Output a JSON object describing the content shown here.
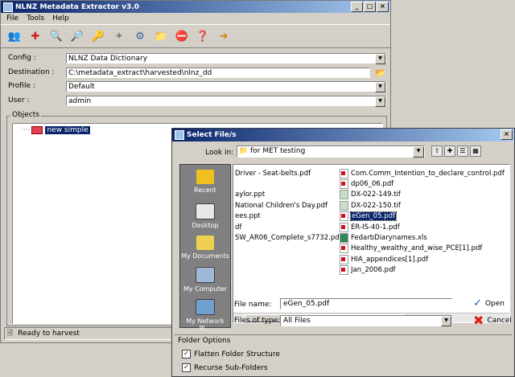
{
  "main_window": {
    "title": "NLNZ Metadata Extractor v3.0",
    "menu": [
      "File",
      "Tools",
      "Help"
    ],
    "toolbar_icons": [
      "users-icon",
      "add-icon",
      "search-icon",
      "search-delete-icon",
      "key-icon",
      "puzzle-icon",
      "config-icon",
      "export-icon",
      "stop-icon",
      "help-icon",
      "exit-icon"
    ],
    "fields": {
      "config_label": "Config :",
      "config_value": "NLNZ Data Dictionary",
      "destination_label": "Destination :",
      "destination_value": "C:\\metadata_extract\\harvested\\nlnz_dd",
      "profile_label": "Profile :",
      "profile_value": "Default",
      "user_label": "User :",
      "user_value": "admin"
    },
    "objects_label": "Objects",
    "tree_item": "new simple",
    "status": "Ready to harvest"
  },
  "dialog": {
    "title": "Select File/s",
    "look_in_label": "Look in:",
    "look_in_value": "for MET testing",
    "places": [
      "Recent",
      "Desktop",
      "My Documents",
      "My Computer",
      "My Network Pl..."
    ],
    "files_col1": [
      "Driver - Seat-belts.pdf",
      "",
      "aylor.ppt",
      "National Children's Day.pdf",
      "ees.ppt",
      "df",
      "SW_AR06_Complete_s7732.pdf"
    ],
    "files_col2": [
      {
        "name": "Com.Comm_Intention_to_declare_control.pdf",
        "type": "pdf"
      },
      {
        "name": "dp06_06.pdf",
        "type": "pdf"
      },
      {
        "name": "DX-022-149.tif",
        "type": "tif"
      },
      {
        "name": "DX-022-150.tif",
        "type": "tif"
      },
      {
        "name": "eGen_05.pdf",
        "type": "pdf"
      },
      {
        "name": "ER-IS-40-1.pdf",
        "type": "pdf"
      },
      {
        "name": "FedarbDiarynames.xls",
        "type": "xls"
      },
      {
        "name": "Healthy_wealthy_and_wise_PCE[1].pdf",
        "type": "pdf"
      },
      {
        "name": "HIA_appendices[1].pdf",
        "type": "pdf"
      },
      {
        "name": "Jan_2006.pdf",
        "type": "pdf"
      }
    ],
    "selected_file": "eGen_05.pdf",
    "file_name_label": "File name:",
    "file_name_value": "eGen_05.pdf",
    "files_of_type_label": "Files of type:",
    "files_of_type_value": "All Files",
    "open_label": "Open",
    "cancel_label": "Cancel",
    "folder_options_label": "Folder Options",
    "flatten_label": "Flatten Folder Structure",
    "recurse_label": "Recurse Sub-Folders"
  },
  "colors": {
    "titlebar": "#0a246a",
    "selection": "#0a246a",
    "face": "#d4d0c8"
  }
}
